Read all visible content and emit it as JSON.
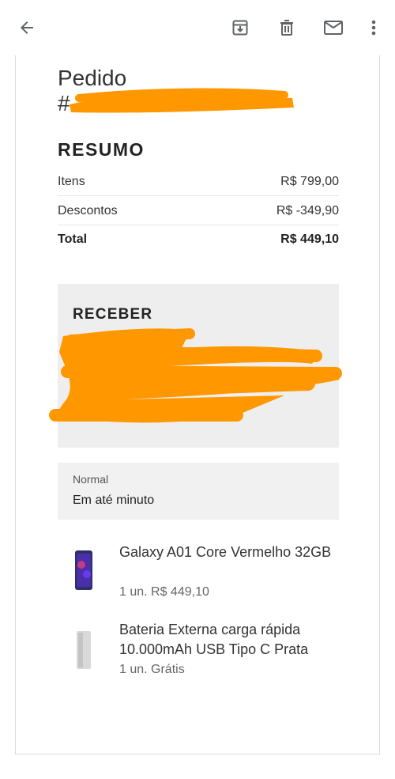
{
  "toolbar": {
    "back_icon": "arrow-left-icon",
    "archive_icon": "archive-icon",
    "delete_icon": "trash-icon",
    "mail_icon": "mail-icon",
    "more_icon": "more-vert-icon"
  },
  "order": {
    "title": "Pedido",
    "number_prefix": "#"
  },
  "resumo": {
    "title": "RESUMO",
    "rows": [
      {
        "label": "Itens",
        "value": "R$ 799,00"
      },
      {
        "label": "Descontos",
        "value": "R$ -349,90"
      },
      {
        "label": "Total",
        "value": "R$ 449,10"
      }
    ]
  },
  "receber": {
    "title": "RECEBER"
  },
  "shipping": {
    "type": "Normal",
    "time": "Em até minuto"
  },
  "items": [
    {
      "name": "Galaxy A01 Core Vermelho 32GB",
      "meta": "1 un. R$ 449,10"
    },
    {
      "name": "Bateria Externa carga rápida 10.000mAh USB Tipo C Prata",
      "meta": "1 un. Grátis"
    }
  ],
  "colors": {
    "redaction": "#ff9800",
    "panel": "#eeeeee",
    "border": "#dadce0"
  }
}
